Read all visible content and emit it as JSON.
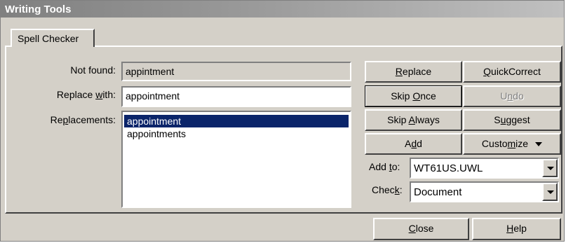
{
  "window": {
    "title": "Writing Tools"
  },
  "tabs": [
    {
      "label": "Spell Checker"
    }
  ],
  "form": {
    "not_found_label": "Not found:",
    "not_found_value": "appintment",
    "replace_with_label_pre": "Replace ",
    "replace_with_label_key": "w",
    "replace_with_label_post": "ith:",
    "replace_with_value": "appointment",
    "replacements_label_pre": "Re",
    "replacements_label_key": "p",
    "replacements_label_post": "lacements:",
    "replacements": [
      "appointment",
      "appointments"
    ],
    "selected_replacement_index": 0
  },
  "buttons": {
    "replace": {
      "key": "R",
      "rest": "eplace"
    },
    "quickcorrect": {
      "key": "Q",
      "rest": "uickCorrect"
    },
    "skip_once": {
      "pre": "Skip ",
      "key": "O",
      "rest": "nce"
    },
    "undo": {
      "pre": "U",
      "key": "n",
      "rest": "do"
    },
    "skip_always": {
      "pre": "Skip ",
      "key": "A",
      "rest": "lways"
    },
    "suggest": {
      "pre": "S",
      "key": "u",
      "rest": "ggest"
    },
    "add": {
      "pre": "A",
      "key": "d",
      "rest": "d"
    },
    "customize": {
      "pre": "Custo",
      "key": "m",
      "rest": "ize"
    },
    "close": {
      "key": "C",
      "rest": "lose"
    },
    "help": {
      "key": "H",
      "rest": "elp"
    }
  },
  "add_to": {
    "label_pre": "Add ",
    "label_key": "t",
    "label_post": "o:",
    "value": "WT61US.UWL"
  },
  "check": {
    "label_pre": "Chec",
    "label_key": "k",
    "label_post": ":",
    "value": "Document"
  },
  "colors": {
    "selection": "#0a246a",
    "face": "#d4d0c8"
  }
}
